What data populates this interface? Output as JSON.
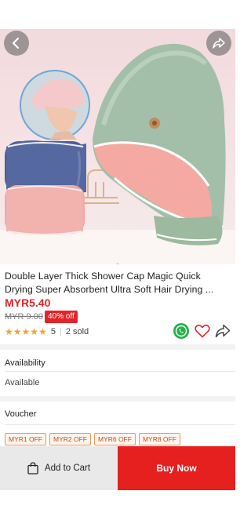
{
  "product": {
    "title_line1": "Double Layer Thick Shower Cap Magic Quick",
    "title_line2": "Drying Super Absorbent Ultra Soft Hair Drying ...",
    "price": "MYR5.40",
    "original_price": "MYR 9.00",
    "discount": "40% off",
    "rating": "5",
    "sold": "2 sold",
    "image_count_dots": 1
  },
  "availability": {
    "label": "Availability",
    "value": "Available"
  },
  "voucher": {
    "label": "Voucher",
    "items": [
      "MYR1 OFF",
      "MYR2 OFF",
      "MYR6 OFF",
      "MYR8 OFF"
    ]
  },
  "bottom_bar": {
    "add_to_cart": "Add to Cart",
    "buy_now": "Buy Now"
  },
  "icons": {
    "back": "chevron-left-icon",
    "share": "share-icon",
    "whatsapp": "whatsapp-icon",
    "favorite": "heart-icon",
    "share_action": "share-arrow-icon",
    "cart": "shopping-bag-icon"
  },
  "colors": {
    "accent_red": "#e5201f",
    "price_red": "#e3232a",
    "star": "#f2a23a",
    "whatsapp_green": "#25b04a",
    "voucher_border": "#e89a5a"
  }
}
